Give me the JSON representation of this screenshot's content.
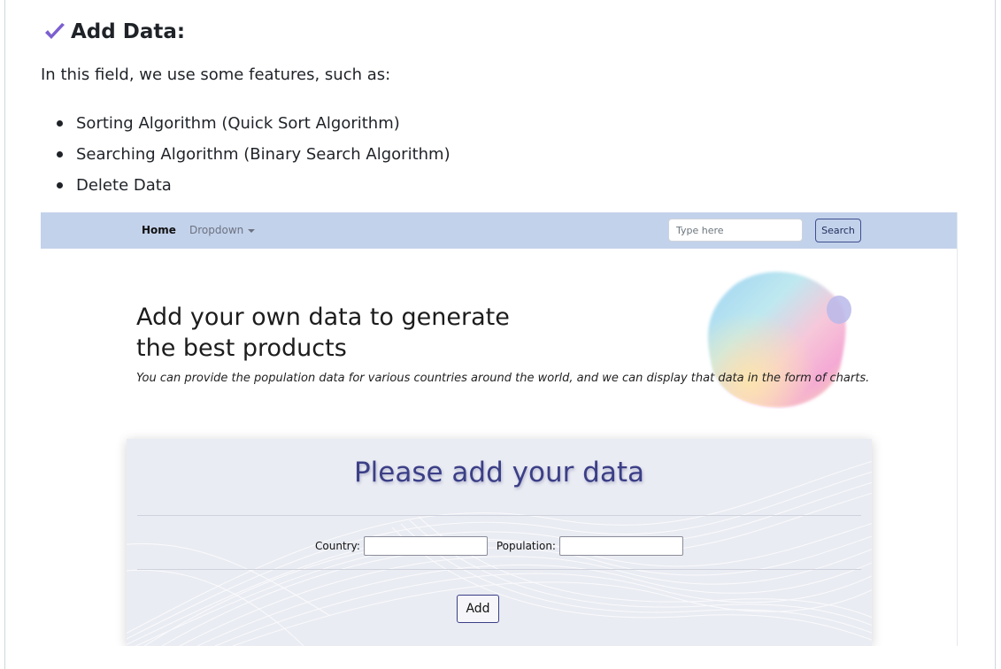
{
  "section": {
    "heading": "Add Data:",
    "intro": "In this field, we use some features, such as:",
    "features": [
      "Sorting Algorithm (Quick Sort Algorithm)",
      "Searching Algorithm (Binary Search Algorithm)",
      "Delete Data"
    ]
  },
  "app": {
    "navbar": {
      "home": "Home",
      "dropdown": "Dropdown",
      "search_placeholder": "Type here",
      "search_button": "Search"
    },
    "hero": {
      "title_line1": "Add your own data to generate",
      "title_line2": "the best products",
      "subtitle": "You can provide the population data for various countries around the world, and we can display that data in the form of charts."
    },
    "form": {
      "title": "Please add your data",
      "country_label": "Country:",
      "population_label": "Population:",
      "country_value": "",
      "population_value": "",
      "add_button": "Add"
    }
  },
  "colors": {
    "navbar_bg": "#c3d2eb",
    "form_title": "#3b3f86",
    "check_icon": "#7b5fd0"
  }
}
